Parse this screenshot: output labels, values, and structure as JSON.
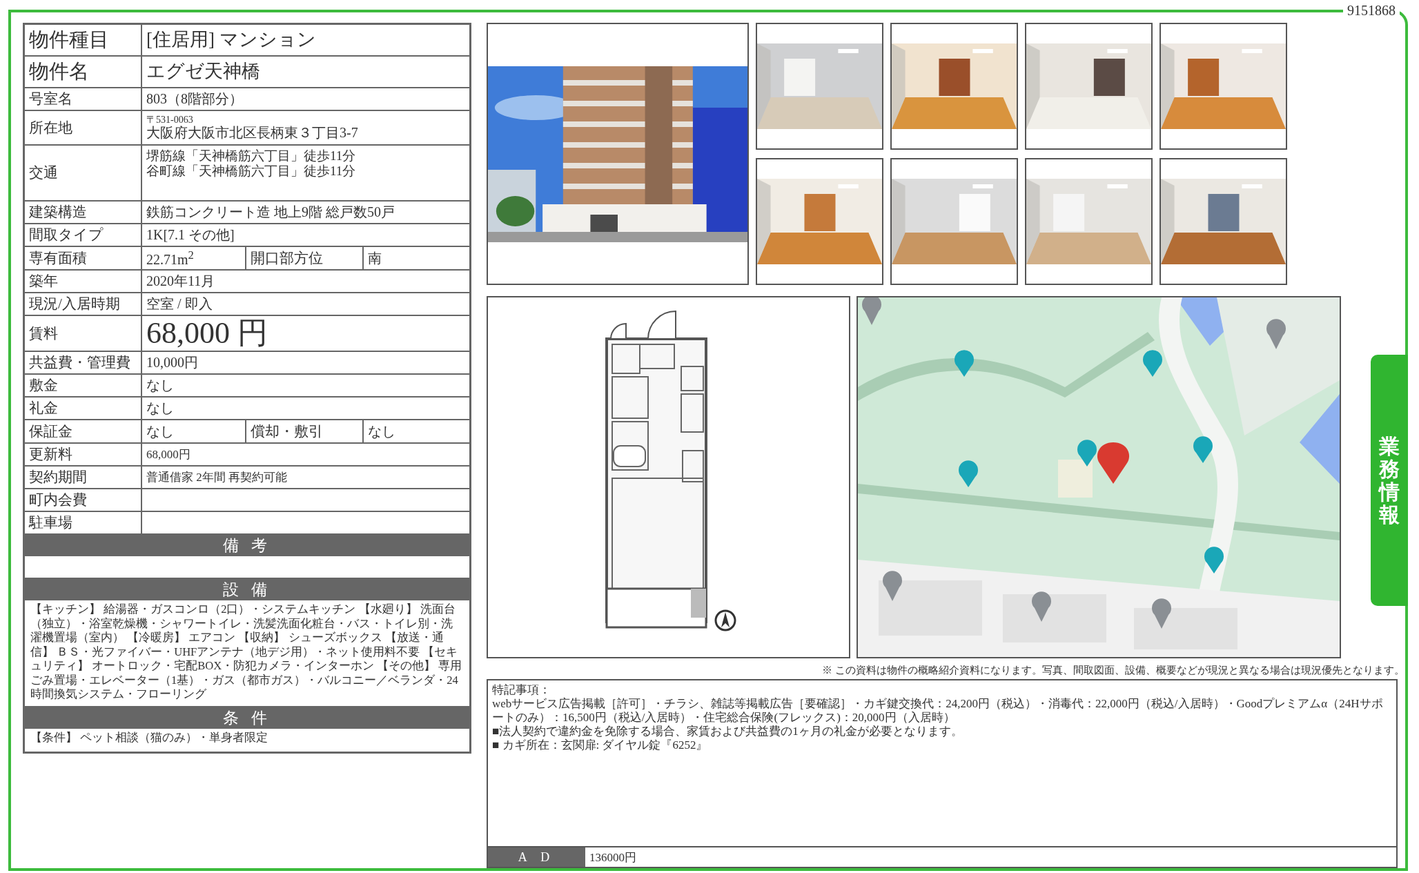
{
  "document_id": "9151868",
  "side_tab": "業務情報",
  "property_table": {
    "rows": [
      {
        "kind": "title",
        "label": "物件種目",
        "value": "[住居用]  マンション"
      },
      {
        "kind": "title",
        "label": "物件名",
        "value": "エグゼ天神橋"
      },
      {
        "kind": "plain",
        "label": "号室名",
        "value": "803（8階部分）"
      },
      {
        "kind": "address",
        "label": "所在地",
        "postal": "〒531-0063",
        "value": "大阪府大阪市北区長柄東３丁目3-7"
      },
      {
        "kind": "lines",
        "label": "交通",
        "lines": [
          "堺筋線「天神橋筋六丁目」徒歩11分",
          "谷町線「天神橋筋六丁目」徒歩11分"
        ]
      },
      {
        "kind": "plain",
        "label": "建築構造",
        "value": "鉄筋コンクリート造  地上9階  総戸数50戸"
      },
      {
        "kind": "plain",
        "label": "間取タイプ",
        "value": "1K[7.1  その他]"
      },
      {
        "kind": "split",
        "label": "専有面積",
        "value": "22.71m$^{2}$",
        "label_2": "開口部方位",
        "value_2": "南"
      },
      {
        "kind": "plain",
        "label": "築年",
        "value": "2020年11月"
      },
      {
        "kind": "plain",
        "label": "現況/入居時期",
        "value": "空室  /  即入"
      },
      {
        "kind": "price",
        "label": "賃料",
        "value": "68,000 円"
      },
      {
        "kind": "plain",
        "label": "共益費・管理費",
        "value": "10,000円"
      },
      {
        "kind": "plain",
        "label": "敷金",
        "value": "なし"
      },
      {
        "kind": "plain",
        "label": "礼金",
        "value": "なし"
      },
      {
        "kind": "split",
        "label": "保証金",
        "value": "なし",
        "label_2": "償却・敷引",
        "value_2": "なし"
      },
      {
        "kind": "small",
        "label": "更新料",
        "value": "68,000円"
      },
      {
        "kind": "small",
        "label": "契約期間",
        "value": "普通借家  2年間  再契約可能"
      },
      {
        "kind": "plain",
        "label": "町内会費"
      },
      {
        "kind": "plain",
        "label": "駐車場"
      }
    ],
    "sections": [
      {
        "heading": "備 考"
      },
      {
        "heading": "設 備",
        "text": "【キッチン】 給湯器・ガスコンロ（2口）・システムキッチン 【水廻り】 洗面台（独立）・浴室乾燥機・シャワートイレ・洗髪洗面化粧台・バス・トイレ別・洗濯機置場（室内） 【冷暖房】 エアコン 【収納】 シューズボックス 【放送・通信】 ＢＳ・光ファイバー・UHFアンテナ（地デジ用）・ネット使用料不要 【セキュリティ】 オートロック・宅配BOX・防犯カメラ・インターホン 【その他】 専用ごみ置場・エレベーター（1基）・ガス（都市ガス）・バルコニー／ベランダ・24時間換気システム・フローリング"
      },
      {
        "heading": "条 件",
        "text": "【条件】 ペット相談（猫のみ）・単身者限定"
      }
    ]
  },
  "disclaimer": "※ この資料は物件の概略紹介資料になります。写真、間取図面、設備、概要などが現況と異なる場合は現況優先となります。",
  "notes": {
    "title": "特記事項：",
    "lines": [
      "webサービス広告掲載［許可］・チラシ、雑誌等掲載広告［要確認］・カギ鍵交換代：24,200円（税込）・消毒代：22,000円（税込/入居時）・Goodプレミアムα（24Hサポートのみ）：16,500円（税込/入居時）・住宅総合保険(フレックス)：20,000円（入居時）",
      "■法人契約で違約金を免除する場合、家賃および共益費の1ヶ月の礼金が必要となります。",
      "■ カギ所在：玄関扉: ダイヤル錠『6252』"
    ]
  },
  "ad": {
    "label": "A D",
    "value": "136000円"
  }
}
